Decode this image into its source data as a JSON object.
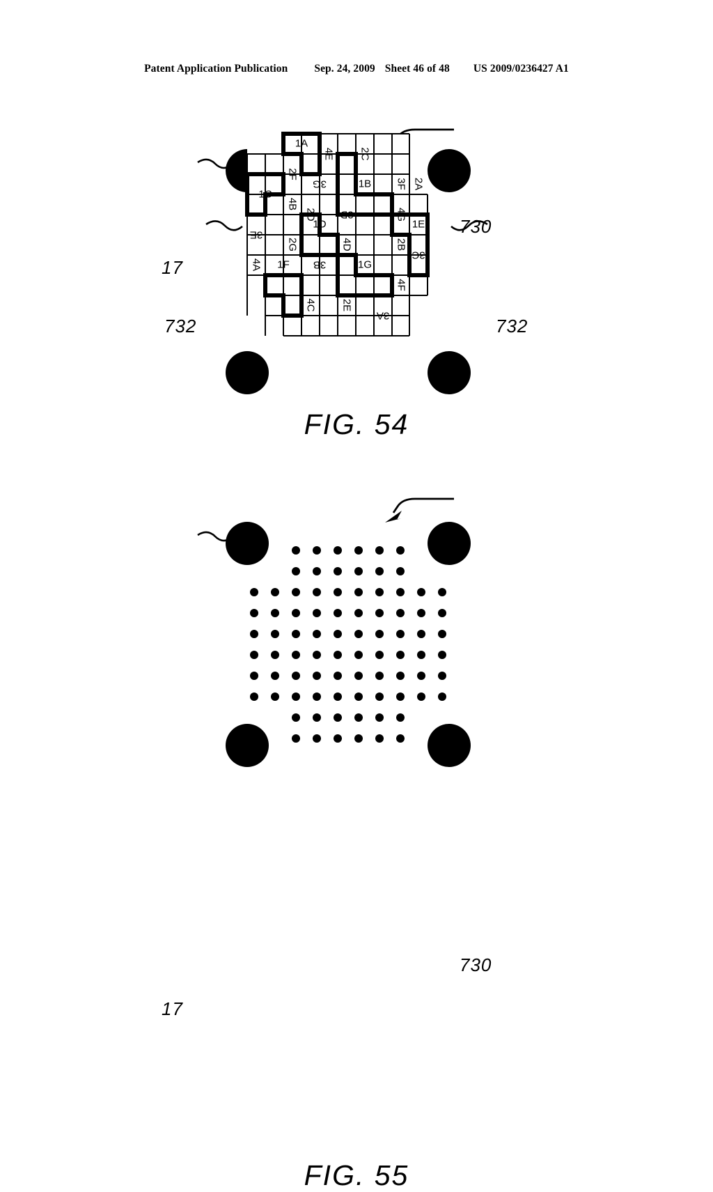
{
  "header": {
    "publication": "Patent Application Publication",
    "date": "Sep. 24, 2009",
    "sheet": "Sheet 46 of 48",
    "docnum": "US 2009/0236427 A1"
  },
  "figures": [
    {
      "id": "fig54",
      "caption": "FIG. 54",
      "type": "tag-pattern-tiling",
      "callouts": [
        {
          "label": "730",
          "name": "ref-730",
          "kind": "arrow"
        },
        {
          "label": "17",
          "name": "ref-17",
          "kind": "squiggle"
        },
        {
          "label": "732",
          "name": "ref-732-left",
          "kind": "squiggle"
        },
        {
          "label": "732",
          "name": "ref-732-right",
          "kind": "squiggle"
        }
      ],
      "corner_targets": 4,
      "tile_labels": [
        "1A",
        "4E",
        "2C",
        "2F",
        "3G",
        "1B",
        "3F",
        "2A",
        "1C",
        "4B",
        "2D",
        "3D",
        "4G",
        "1E",
        "3E",
        "2G",
        "1D",
        "4D",
        "2B",
        "3C",
        "4A",
        "1F",
        "3B",
        "1G",
        "4F",
        "4C",
        "2E",
        "3A"
      ]
    },
    {
      "id": "fig55",
      "caption": "FIG. 55",
      "type": "dot-pattern",
      "callouts": [
        {
          "label": "730",
          "name": "ref-730",
          "kind": "arrow"
        },
        {
          "label": "17",
          "name": "ref-17",
          "kind": "squiggle"
        }
      ],
      "corner_targets": 4
    }
  ],
  "chart_data": {
    "type": "scatter",
    "title": "FIG. 55",
    "xlabel": "",
    "ylabel": "",
    "grid": false,
    "legend": null,
    "description": "10 x 10 dot matrix with the four 2x2 corner blocks omitted (84 dots), flanked by four solid circular alignment targets.",
    "columns": 10,
    "rows": 10,
    "dot_spacing_px": 30,
    "dot_radius_px": 6,
    "omitted_corner_block": [
      2,
      2
    ],
    "total_dots": 84,
    "row_counts": [
      6,
      6,
      10,
      10,
      10,
      10,
      10,
      10,
      6,
      6
    ],
    "corner_target_radius_px": 30
  },
  "colors": {
    "ink": "#000000",
    "paper": "#ffffff"
  }
}
